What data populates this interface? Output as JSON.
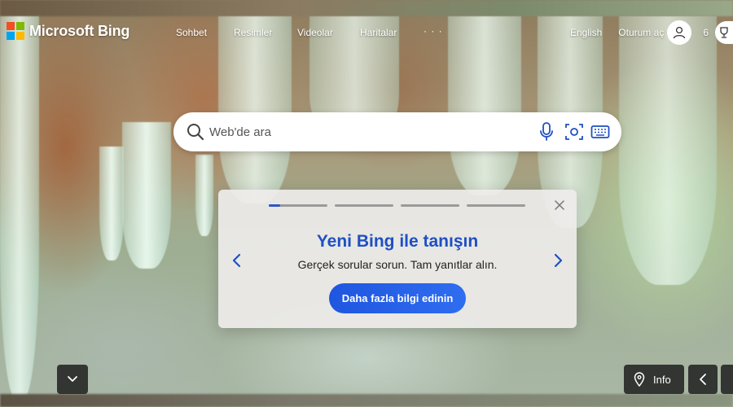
{
  "brand": {
    "name": "Microsoft Bing",
    "logo_colors": [
      "#f25022",
      "#7fba00",
      "#00a4ef",
      "#ffb900"
    ]
  },
  "nav": {
    "items": [
      "Sohbet",
      "Resimler",
      "Videolar",
      "Haritalar"
    ],
    "more": "· · ·"
  },
  "header": {
    "language": "English",
    "signin": "Oturum aç",
    "rewards_points": "6"
  },
  "search": {
    "placeholder": "Web'de ara",
    "icons": [
      "search-icon",
      "microphone-icon",
      "visual-search-icon",
      "keyboard-icon"
    ]
  },
  "promo": {
    "title": "Yeni Bing ile tanışın",
    "subtitle": "Gerçek sorular sorun. Tam yanıtlar alın.",
    "button": "Daha fazla bilgi edinin",
    "slides": 4,
    "active_slide": 1,
    "accent": "#1e4fc4"
  },
  "footer_controls": {
    "info_label": "Info"
  }
}
